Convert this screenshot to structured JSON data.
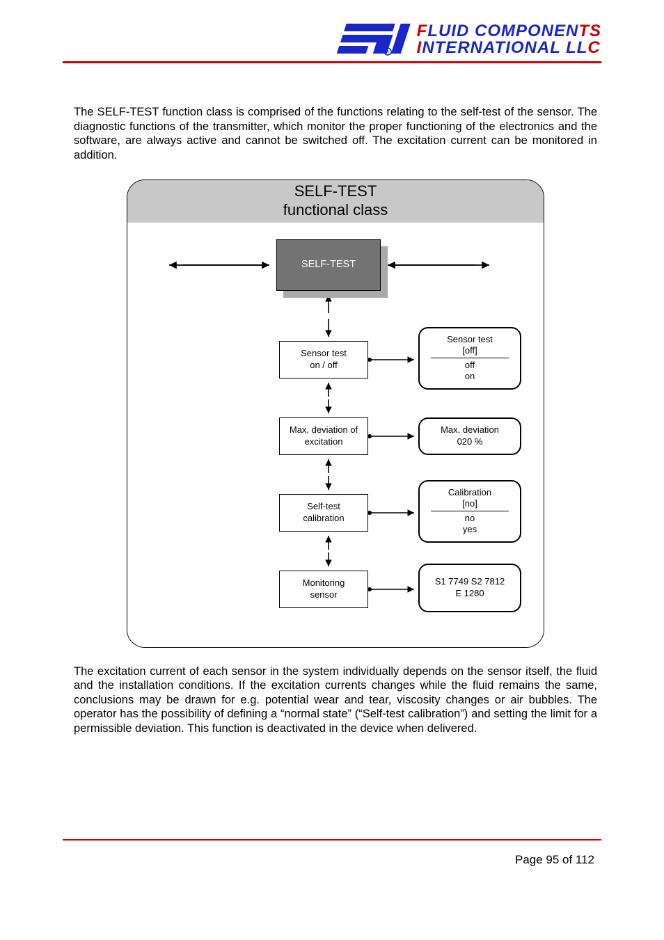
{
  "logo_top": "FLUID COMPONENTS",
  "logo_bottom": "INTERNATIONAL LLC",
  "para1": "The SELF-TEST function class is comprised of the functions relating to the self-test of the sensor. The diagnostic functions of the transmitter, which monitor the proper functioning of the electronics and the software, are always active and cannot be switched off. The excitation current can be monitored in addition.",
  "diagram": {
    "title1": "SELF-TEST",
    "title2": "functional class",
    "main": "SELF-TEST",
    "left": {
      "b1l1": "Sensor test",
      "b1l2": "on / off",
      "b2l1": "Max. deviation of",
      "b2l2": "excitation",
      "b3l1": "Self-test",
      "b3l2": "calibration",
      "b4l1": "Monitoring",
      "b4l2": "sensor"
    },
    "right": {
      "b1l1": "Sensor test",
      "b1l2": "[off]",
      "b1l3": "off",
      "b1l4": "on",
      "b2l1": "Max. deviation",
      "b2l2": "020 %",
      "b3l1": "Calibration",
      "b3l2": "[no]",
      "b3l3": "no",
      "b3l4": "yes",
      "b4l1": "S1 7749   S2 7812",
      "b4l2": "E 1280"
    }
  },
  "para2": "The excitation current of each sensor in the system individually depends on the sensor itself, the fluid and the installation conditions. If the excitation currents changes while the fluid remains the same, conclusions may be drawn for e.g. potential wear and tear, viscosity changes or air bubbles. The operator has the possibility of defining a “normal state” (“Self-test calibration”) and setting the limit for a permissible deviation. This function is deactivated in the device when delivered.",
  "page_label": "Page 95 of 112"
}
